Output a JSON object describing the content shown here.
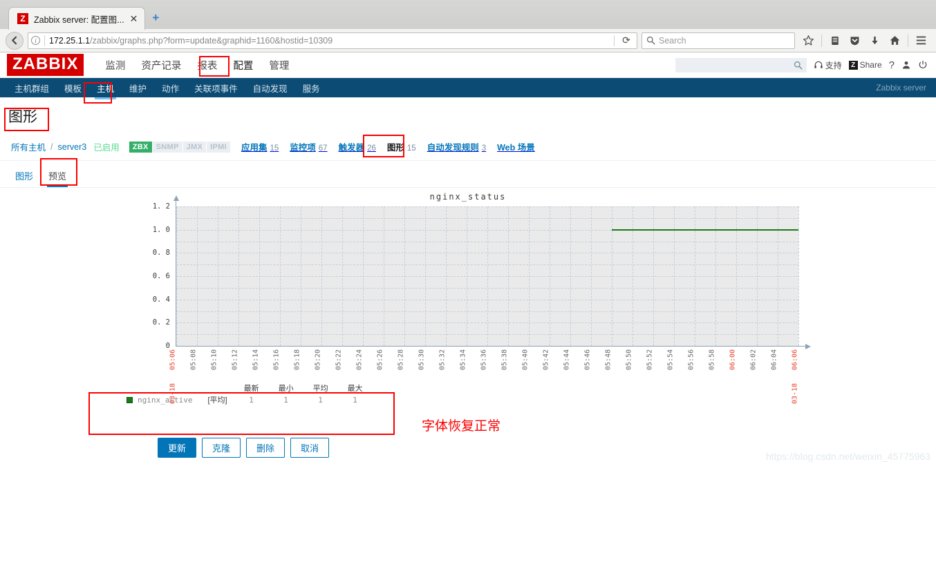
{
  "browser": {
    "tab": {
      "favicon_letter": "Z",
      "title": "Zabbix server: 配置图...",
      "close_label": "✕"
    },
    "new_tab_label": "+",
    "back_label": "←",
    "url_host": "172.25.1.1",
    "url_path": "/zabbix/graphs.php?form=update&graphid=1160&hostid=10309",
    "reload_label": "⟳",
    "search_placeholder": "Search",
    "icons": [
      "bookmark-star-icon",
      "library-icon",
      "pocket-shield-icon",
      "download-icon",
      "home-icon",
      "menu-icon"
    ]
  },
  "zabbix_header": {
    "logo": "ZABBIX",
    "nav": [
      {
        "label": "监测",
        "active": false
      },
      {
        "label": "资产记录",
        "active": false
      },
      {
        "label": "报表",
        "active": false
      },
      {
        "label": "配置",
        "active": true
      },
      {
        "label": "管理",
        "active": false
      }
    ],
    "search_value": "",
    "support_label": "支持",
    "share_label": "Share",
    "share_badge": "Z",
    "help_label": "?",
    "user_icon": "user-icon",
    "power_icon": "power-icon"
  },
  "subnav": {
    "items": [
      {
        "label": "主机群组",
        "active": false
      },
      {
        "label": "模板",
        "active": false
      },
      {
        "label": "主机",
        "active": true
      },
      {
        "label": "维护",
        "active": false
      },
      {
        "label": "动作",
        "active": false
      },
      {
        "label": "关联项事件",
        "active": false
      },
      {
        "label": "自动发现",
        "active": false
      },
      {
        "label": "服务",
        "active": false
      }
    ],
    "server_label": "Zabbix server"
  },
  "page": {
    "title": "图形",
    "breadcrumb": {
      "all_hosts": "所有主机",
      "separator": "/",
      "host": "server3",
      "status": "已启用",
      "protocols": [
        {
          "label": "ZBX",
          "enabled": true
        },
        {
          "label": "SNMP",
          "enabled": false
        },
        {
          "label": "JMX",
          "enabled": false
        },
        {
          "label": "IPMI",
          "enabled": false
        }
      ],
      "items": [
        {
          "label": "应用集",
          "count": "15",
          "current": false
        },
        {
          "label": "监控项",
          "count": "67",
          "current": false
        },
        {
          "label": "触发器",
          "count": "26",
          "current": false
        },
        {
          "label": "图形",
          "count": "15",
          "current": true
        },
        {
          "label": "自动发现规则",
          "count": "3",
          "current": false
        },
        {
          "label": "Web 场景",
          "count": "",
          "current": false
        }
      ]
    },
    "tabs": [
      {
        "label": "图形",
        "active": false
      },
      {
        "label": "预览",
        "active": true
      }
    ],
    "buttons": [
      {
        "label": "更新",
        "primary": true
      },
      {
        "label": "克隆",
        "primary": false
      },
      {
        "label": "删除",
        "primary": false
      },
      {
        "label": "取消",
        "primary": false
      }
    ]
  },
  "annotation": {
    "note_text": "字体恢复正常",
    "color": "#fc0000"
  },
  "watermark": "https://blog.csdn.net/weixin_45775963",
  "chart_data": {
    "type": "line",
    "title": "nginx_status",
    "xlabel": "",
    "ylabel": "",
    "ylim": [
      0,
      1.2
    ],
    "ytick_labels": [
      "1. 2",
      "1. 0",
      "0. 8",
      "0. 6",
      "0. 4",
      "0. 2",
      "0"
    ],
    "ytick_values": [
      1.2,
      1.0,
      0.8,
      0.6,
      0.4,
      0.2,
      0
    ],
    "grid": true,
    "legend_position": "below",
    "xtick_labels": [
      "05:06",
      "05:08",
      "05:10",
      "05:12",
      "05:14",
      "05:16",
      "05:18",
      "05:20",
      "05:22",
      "05:24",
      "05:26",
      "05:28",
      "05:30",
      "05:32",
      "05:34",
      "05:36",
      "05:38",
      "05:40",
      "05:42",
      "05:44",
      "05:46",
      "05:48",
      "05:50",
      "05:52",
      "05:54",
      "05:56",
      "05:58",
      "06:00",
      "06:02",
      "06:04",
      "06:06"
    ],
    "xtick_highlight_indices": [
      0,
      27,
      30
    ],
    "xaxis_start_date": "03-18",
    "xaxis_end_date": "03-18",
    "series": [
      {
        "name": "nginx_active",
        "aggregation": "[平均]",
        "color": "#1a7a1a",
        "value": 1,
        "data_start_tick": "05:48",
        "data_end_tick": "06:06"
      }
    ],
    "legend": {
      "headers": [
        "最新",
        "最小",
        "平均",
        "最大"
      ],
      "rows": [
        {
          "name": "nginx_active",
          "aggregation": "[平均]",
          "values": [
            "1",
            "1",
            "1",
            "1"
          ]
        }
      ]
    }
  }
}
